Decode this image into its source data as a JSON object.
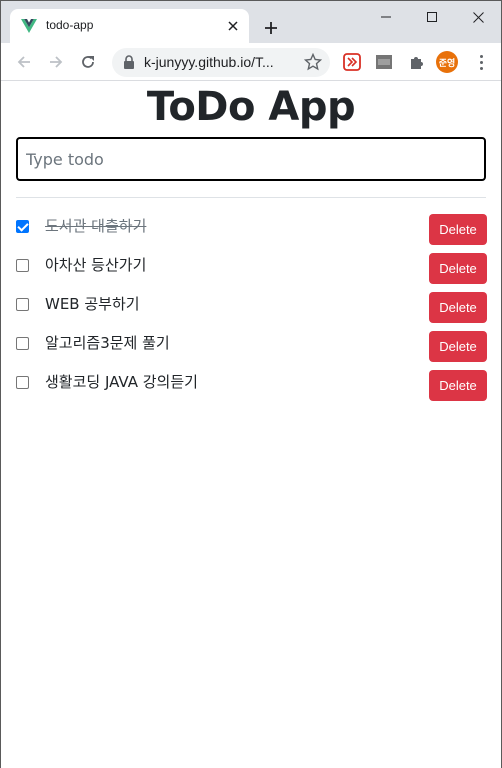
{
  "browser": {
    "tab_title": "todo-app",
    "url": "k-junyyy.github.io/T...",
    "profile_initials": "준영",
    "icons": {
      "favicon": "vue-logo-icon",
      "close": "close-icon",
      "newtab": "plus-icon",
      "back": "arrow-left-icon",
      "forward": "arrow-right-icon",
      "reload": "reload-icon",
      "lock": "lock-icon",
      "bookmark": "star-icon",
      "extensions": "puzzle-icon",
      "menu": "kebab-menu-icon"
    },
    "accent_profile": "#e8710a"
  },
  "app": {
    "title": "ToDo App",
    "input_placeholder": "Type todo",
    "input_value": "",
    "delete_color": "#dc3545",
    "todos": [
      {
        "text": "도서관 대출하기",
        "done": true,
        "delete_label": "Delete"
      },
      {
        "text": "아차산 등산가기",
        "done": false,
        "delete_label": "Delete"
      },
      {
        "text": "WEB 공부하기",
        "done": false,
        "delete_label": "Delete"
      },
      {
        "text": "알고리즘3문제 풀기",
        "done": false,
        "delete_label": "Delete"
      },
      {
        "text": "생활코딩 JAVA 강의듣기",
        "done": false,
        "delete_label": "Delete"
      }
    ]
  }
}
